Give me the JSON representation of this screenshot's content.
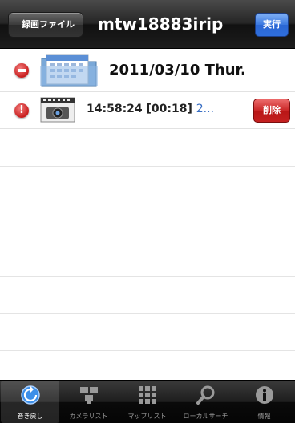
{
  "navbar": {
    "back_label": "録画ファイル",
    "title": "mtw18883irip",
    "action_label": "実行"
  },
  "list": {
    "folder_row": {
      "date": "2011/03/10 Thur."
    },
    "recording_row": {
      "time": "14:58:24 [00:18]",
      "extra": "2...",
      "delete_label": "削除"
    }
  },
  "tabbar": {
    "tabs": [
      {
        "label": "巻き戻し",
        "icon": "rewind-icon",
        "selected": true
      },
      {
        "label": "カメラリスト",
        "icon": "camera-list-icon",
        "selected": false
      },
      {
        "label": "マップリスト",
        "icon": "map-list-icon",
        "selected": false
      },
      {
        "label": "ローカルサーチ",
        "icon": "local-search-icon",
        "selected": false
      },
      {
        "label": "情報",
        "icon": "info-icon",
        "selected": false
      }
    ]
  },
  "colors": {
    "accent_blue": "#2f6fdc",
    "delete_red": "#c42020",
    "tabbar_bg": "#1e1e1e"
  }
}
